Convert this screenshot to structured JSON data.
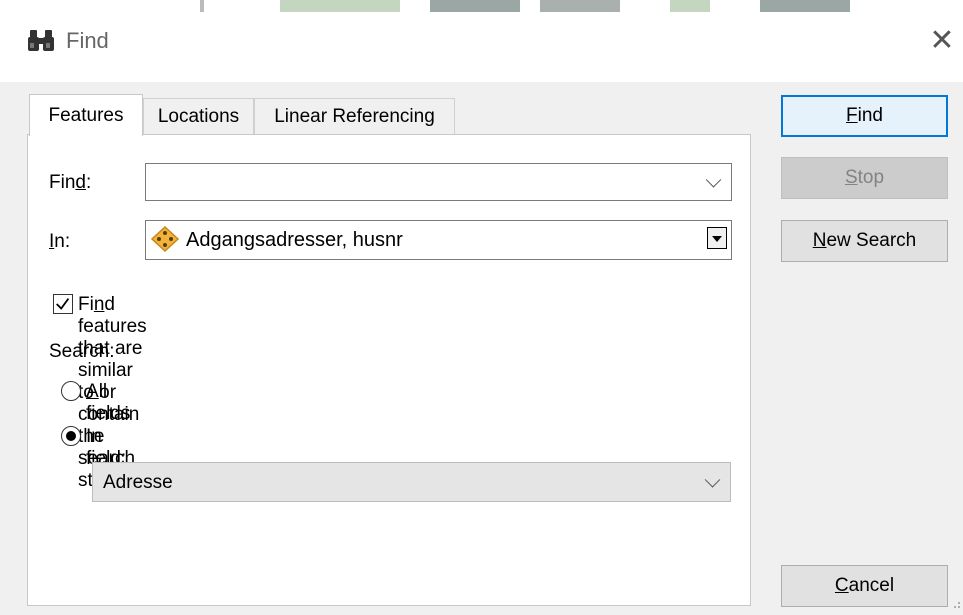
{
  "window": {
    "title": "Find",
    "close_symbol": "✕"
  },
  "tabs": [
    {
      "label": "Features",
      "active": true
    },
    {
      "label": "Locations",
      "active": false
    },
    {
      "label": "Linear Referencing",
      "active": false
    }
  ],
  "find_field": {
    "label_pre": "Fin",
    "label_mnemonic": "d",
    "label_post": ":",
    "value": ""
  },
  "in_field": {
    "label_pre": "",
    "label_mnemonic": "I",
    "label_post": "n:",
    "value": "Adgangsadresser, husnr"
  },
  "similar_checkbox": {
    "label_pre": "Fi",
    "label_mnemonic": "n",
    "label_post": "d features that are similar to or contain the search string",
    "checked": true
  },
  "search": {
    "label": "Search:",
    "all_fields": {
      "label_pre": "",
      "label_mnemonic": "A",
      "label_post": "ll fields",
      "selected": false
    },
    "in_field": {
      "label_pre": "In fie",
      "label_mnemonic": "l",
      "label_post": "d:",
      "selected": true
    },
    "field_value": "Adresse"
  },
  "buttons": {
    "find": {
      "mnemonic": "F",
      "rest": "ind"
    },
    "stop": {
      "mnemonic": "S",
      "rest": "top"
    },
    "new_search": {
      "mnemonic": "N",
      "rest": "ew Search"
    },
    "cancel": {
      "mnemonic": "C",
      "rest": "ancel"
    }
  },
  "colors": {
    "accent": "#0078d7",
    "layer_icon": "#f2b33d"
  }
}
